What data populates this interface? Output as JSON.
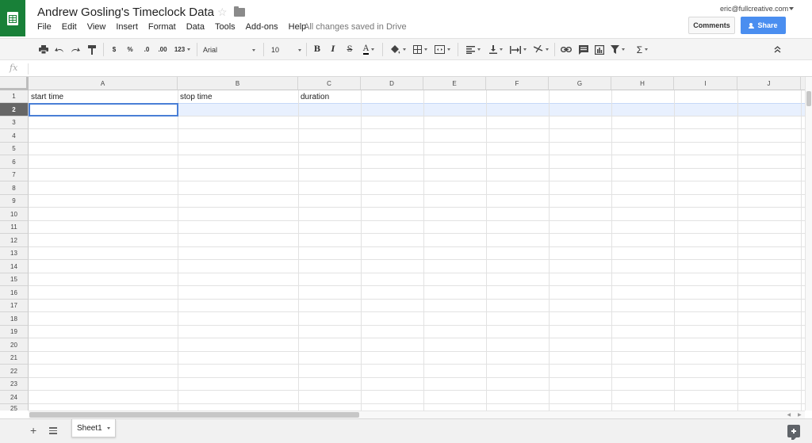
{
  "header": {
    "title": "Andrew Gosling's Timeclock Data",
    "save_status": "All changes saved in Drive",
    "account": "eric@fullcreative.com",
    "comments_label": "Comments",
    "share_label": "Share"
  },
  "menu": [
    "File",
    "Edit",
    "View",
    "Insert",
    "Format",
    "Data",
    "Tools",
    "Add-ons",
    "Help"
  ],
  "toolbar": {
    "currency": "$",
    "percent": "%",
    "decrease_decimals": ".0",
    "increase_decimals": ".00",
    "number_format": "123",
    "font": "Arial",
    "font_size": "10",
    "bold": "B",
    "italic": "I",
    "strikethrough": "S",
    "text_color": "A",
    "functions": "Σ"
  },
  "formula_bar": {
    "fx_label": "fx",
    "value": ""
  },
  "columns": [
    "A",
    "B",
    "C",
    "D",
    "E",
    "F",
    "G",
    "H",
    "I",
    "J"
  ],
  "rows": [
    "1",
    "2",
    "3",
    "4",
    "5",
    "6",
    "7",
    "8",
    "9",
    "10",
    "11",
    "12",
    "13",
    "14",
    "15",
    "16",
    "17",
    "18",
    "19",
    "20",
    "21",
    "22",
    "23",
    "24",
    "25"
  ],
  "active_row": "2",
  "active_cell": "A2",
  "cells": {
    "A1": "start time",
    "B1": "stop time",
    "C1": "duration"
  },
  "sheets": [
    {
      "name": "Sheet1",
      "active": true
    }
  ],
  "colors": {
    "accent": "#4a8ef0",
    "logo": "#188038",
    "selection": "#4a7fd6"
  }
}
